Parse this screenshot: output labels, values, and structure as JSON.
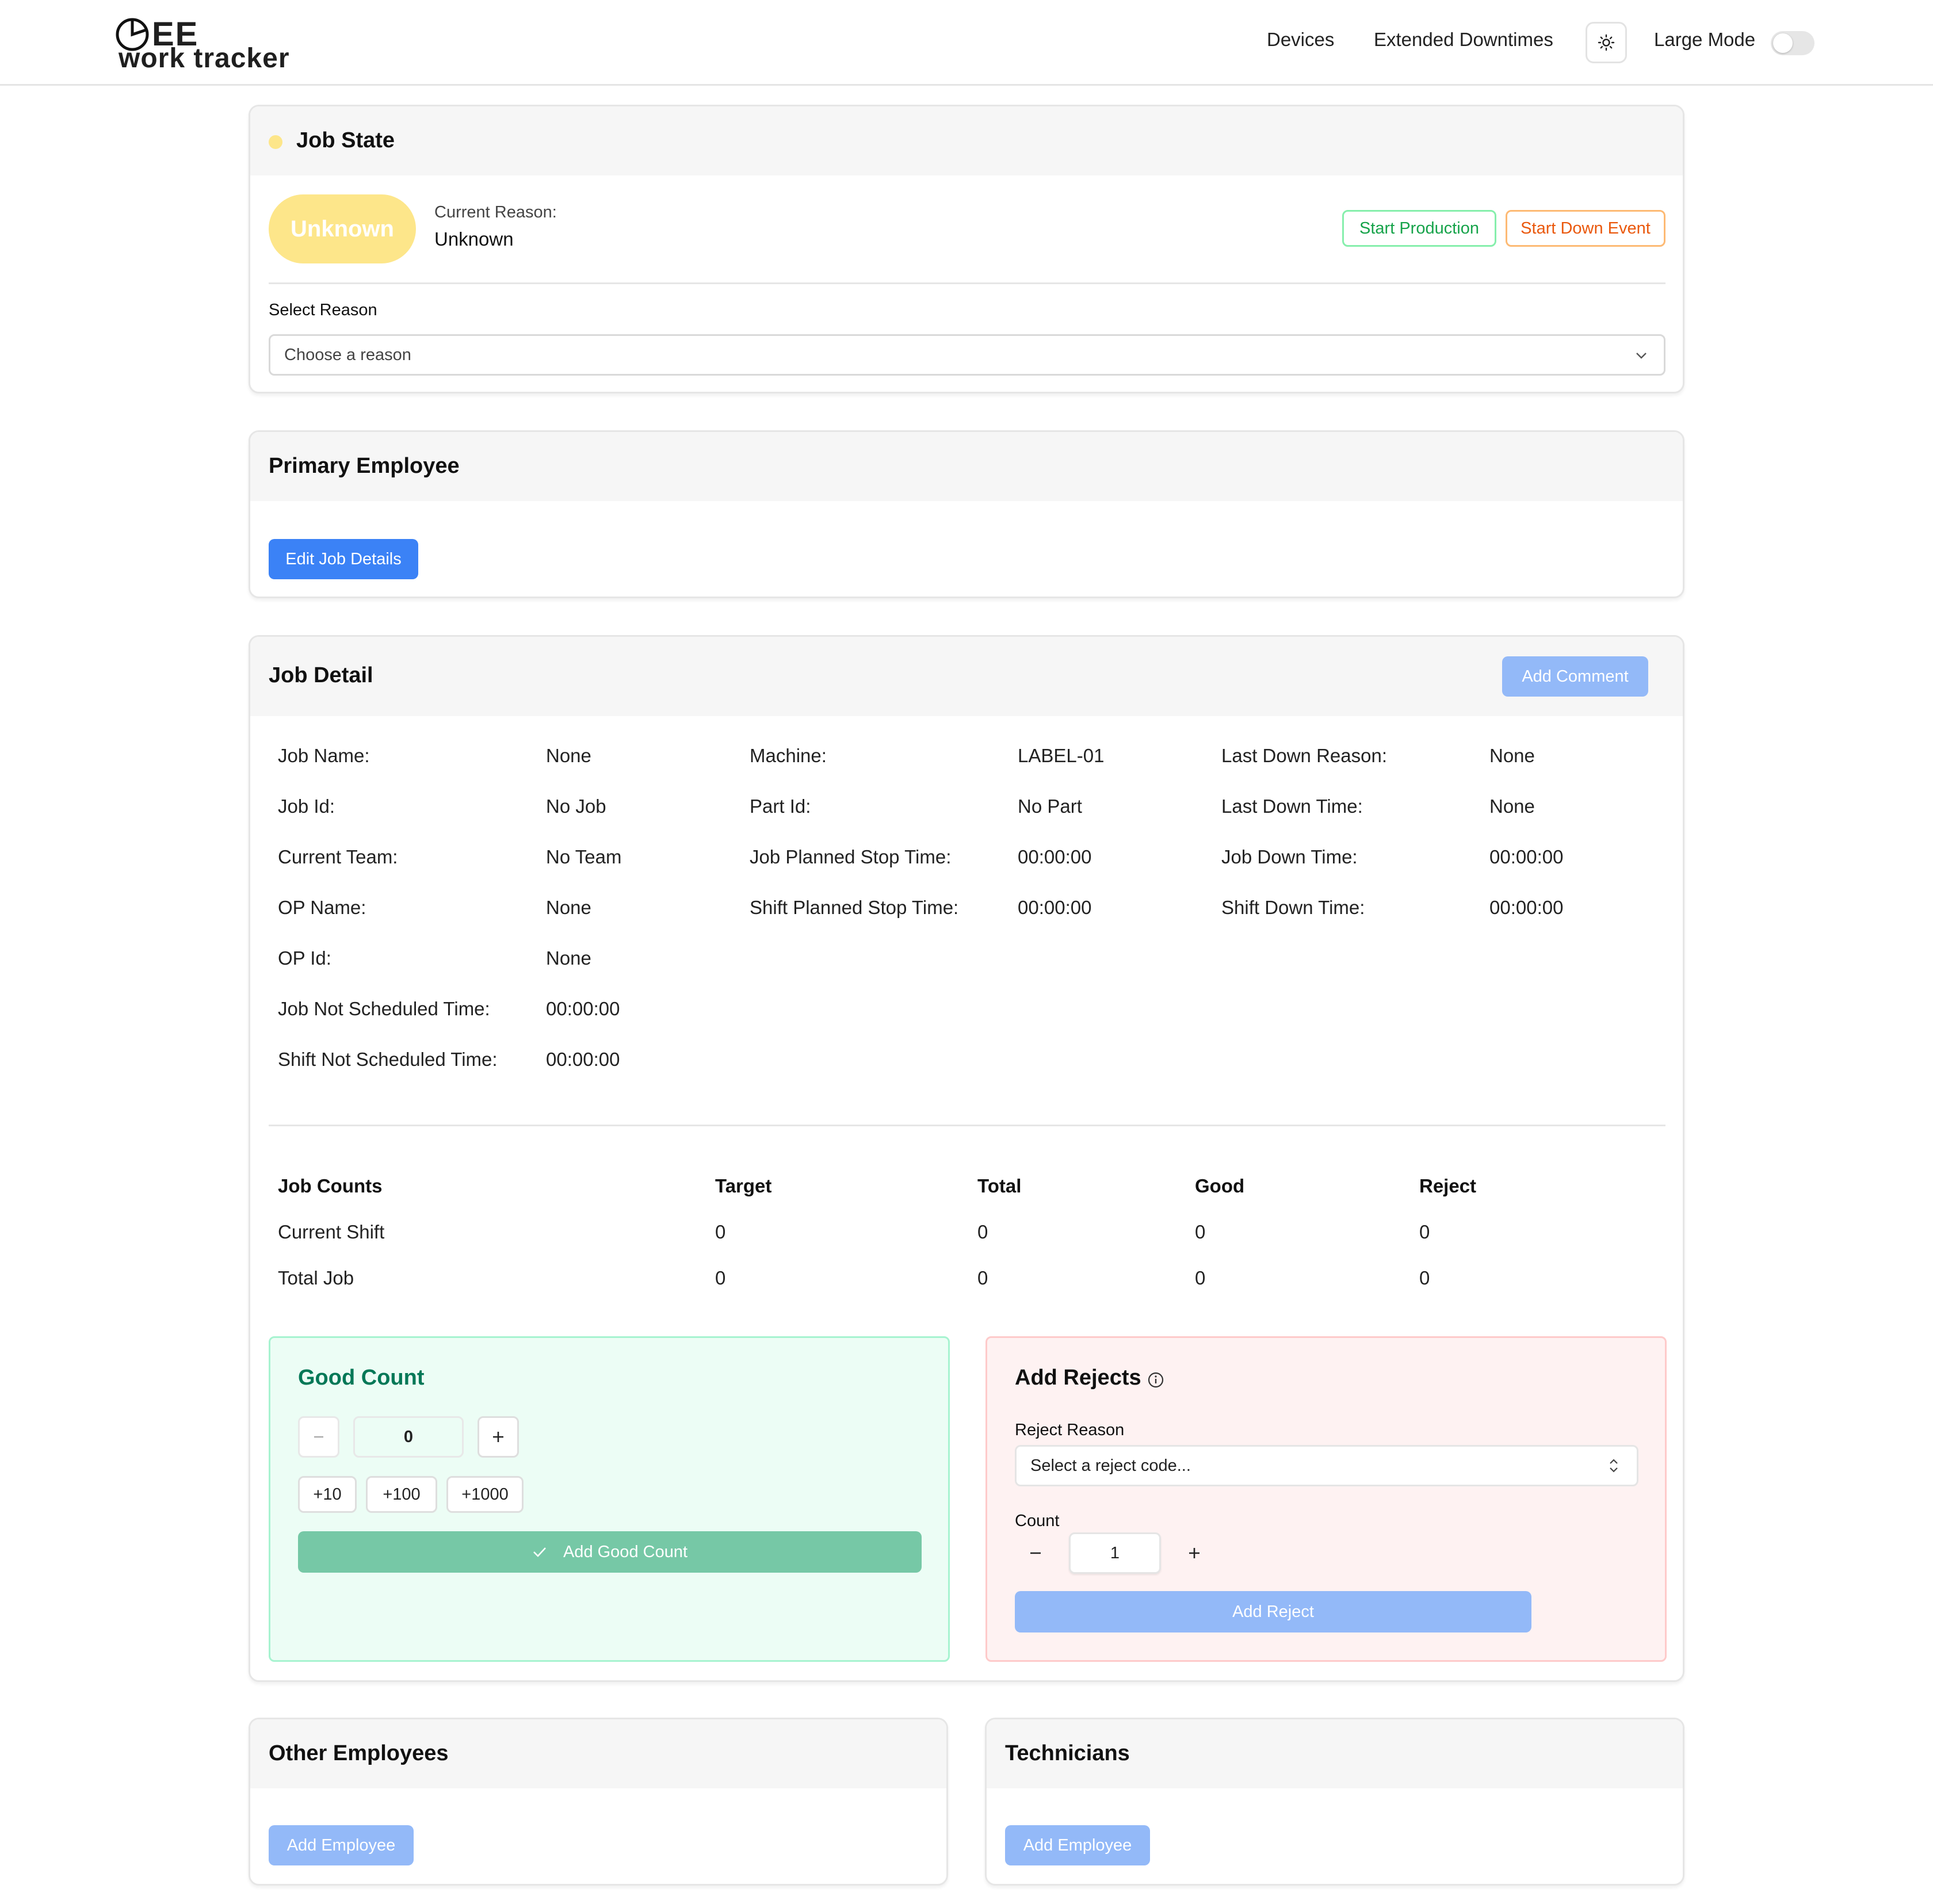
{
  "app": {
    "logo_top": "EE",
    "logo_bottom": "work tracker"
  },
  "nav": {
    "devices": "Devices",
    "extended_downtimes": "Extended Downtimes",
    "large_mode": "Large Mode",
    "large_mode_on": false
  },
  "job_state": {
    "title": "Job State",
    "status_dot_color": "#fde68a",
    "state_badge": "Unknown",
    "current_reason_label": "Current Reason:",
    "current_reason_value": "Unknown",
    "start_production": "Start Production",
    "start_down_event": "Start Down Event",
    "select_reason_label": "Select Reason",
    "select_reason_value": "Choose a reason"
  },
  "primary_employee": {
    "title": "Primary Employee",
    "edit_button": "Edit Job Details"
  },
  "job_detail": {
    "title": "Job Detail",
    "add_comment": "Add Comment",
    "col1": [
      {
        "label": "Job Name:",
        "value": "None"
      },
      {
        "label": "Job Id:",
        "value": "No Job"
      },
      {
        "label": "Current Team:",
        "value": "No Team"
      },
      {
        "label": "OP Name:",
        "value": "None"
      },
      {
        "label": "OP Id:",
        "value": "None"
      },
      {
        "label": "Job Not Scheduled Time:",
        "value": "00:00:00"
      },
      {
        "label": "Shift Not Scheduled Time:",
        "value": "00:00:00"
      }
    ],
    "col2": [
      {
        "label": "Machine:",
        "value": "LABEL-01"
      },
      {
        "label": "Part Id:",
        "value": "No Part"
      },
      {
        "label": "Job Planned Stop Time:",
        "value": "00:00:00"
      },
      {
        "label": "Shift Planned Stop Time:",
        "value": "00:00:00"
      }
    ],
    "col3": [
      {
        "label": "Last Down Reason:",
        "value": "None"
      },
      {
        "label": "Last Down Time:",
        "value": "None"
      },
      {
        "label": "Job Down Time:",
        "value": "00:00:00"
      },
      {
        "label": "Shift Down Time:",
        "value": "00:00:00"
      }
    ],
    "counts": {
      "headers": [
        "Job Counts",
        "Target",
        "Total",
        "Good",
        "Reject"
      ],
      "rows": [
        [
          "Current Shift",
          "0",
          "0",
          "0",
          "0"
        ],
        [
          "Total Job",
          "0",
          "0",
          "0",
          "0"
        ]
      ]
    }
  },
  "good_count": {
    "title": "Good Count",
    "value": "0",
    "inc10": "+10",
    "inc100": "+100",
    "inc1000": "+1000",
    "add_button": "Add Good Count"
  },
  "add_rejects": {
    "title": "Add Rejects",
    "reason_label": "Reject Reason",
    "reason_placeholder": "Select a reject code...",
    "count_label": "Count",
    "count_value": "1",
    "add_button": "Add Reject"
  },
  "other_employees": {
    "title": "Other Employees",
    "add_button": "Add Employee"
  },
  "technicians": {
    "title": "Technicians",
    "add_button": "Add Employee"
  }
}
